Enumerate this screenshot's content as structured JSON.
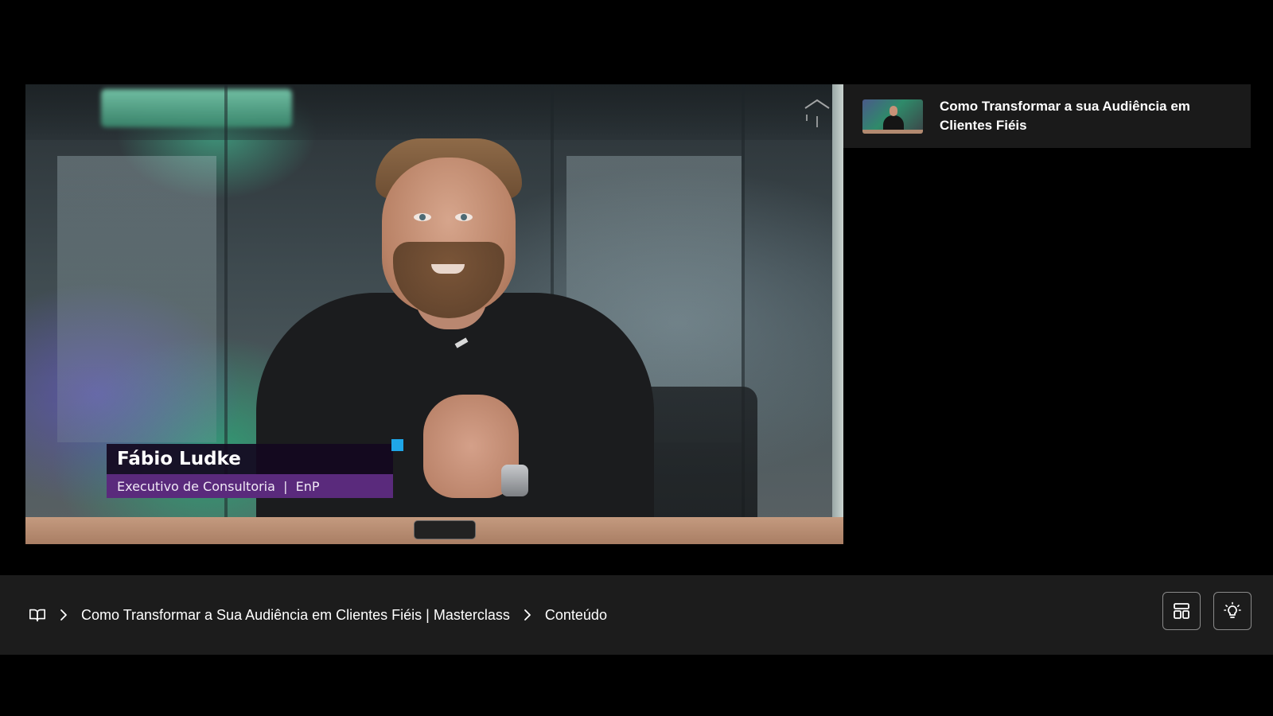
{
  "video": {
    "lower_third": {
      "name": "Fábio Ludke",
      "role": "Executivo de Consultoria  |  EnP"
    }
  },
  "playlist": {
    "items": [
      {
        "title": "Como Transformar a sua Audiência em Clientes Fiéis",
        "thumbnail_icon": "video-thumbnail"
      }
    ]
  },
  "breadcrumb": {
    "home_icon": "book-open-icon",
    "course": "Como Transformar a Sua Audiência em Clientes Fiéis | Masterclass",
    "section": "Conteúdo"
  },
  "actions": {
    "layout_icon": "layout-icon",
    "lightbulb_icon": "lightbulb-icon"
  },
  "colors": {
    "background": "#000000",
    "bar": "#1c1c1c",
    "panel": "#1a1a1a",
    "lower_third_name_bg": "#140820",
    "lower_third_role_bg": "#5a2a7c",
    "accent": "#1fa6e8"
  }
}
